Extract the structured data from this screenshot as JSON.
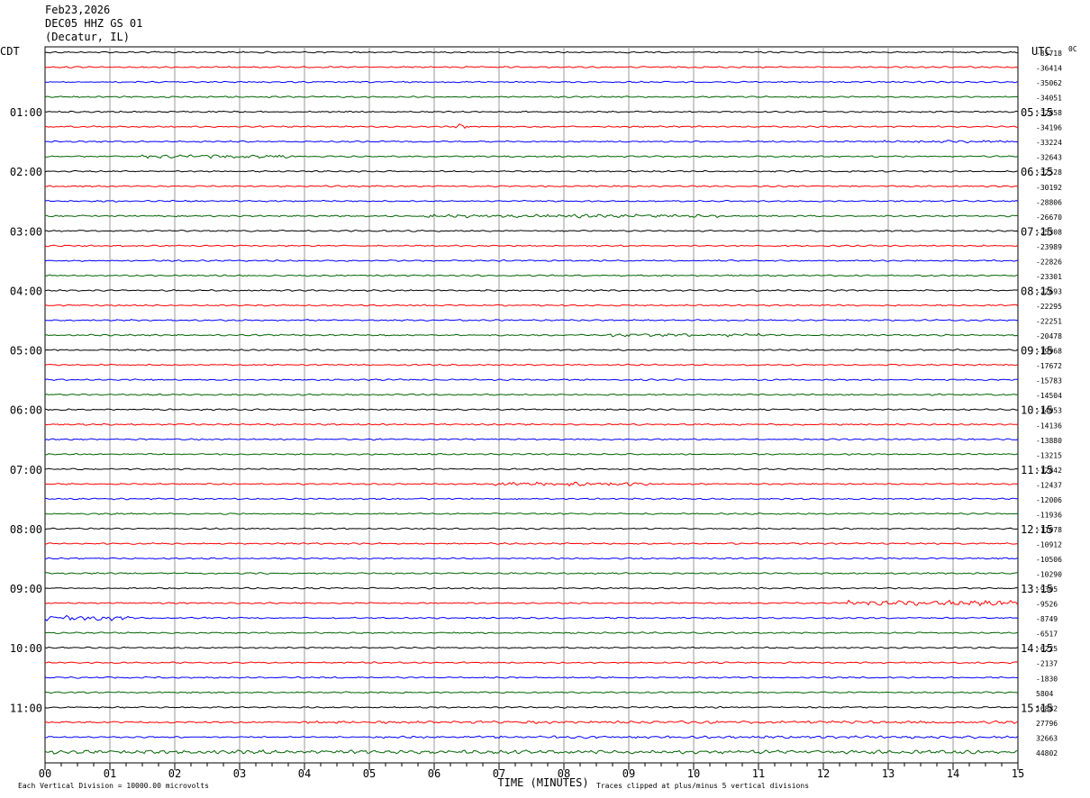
{
  "header": {
    "date": "Feb23,2026",
    "station": "DEC05 HHZ GS 01",
    "location": "(Decatur, IL)"
  },
  "left_timezone": "CDT",
  "right_timezone": "UTC",
  "corner_label": "0C",
  "footer": {
    "vertical_division": "Each Vertical Division = 10000.00 microvolts",
    "xlabel": "TIME (MINUTES)",
    "clip_note": "Traces clipped at plus/minus 5 vertical divisions"
  },
  "colors": {
    "black": "#000000",
    "red": "#ff0000",
    "blue": "#0000ff",
    "green": "#006400",
    "grid": "#999999"
  },
  "chart_data": {
    "type": "line",
    "subtype": "helicorder",
    "xlabel": "TIME (MINUTES)",
    "xlim": [
      0,
      15
    ],
    "x_ticks": [
      "00",
      "01",
      "02",
      "03",
      "04",
      "05",
      "06",
      "07",
      "08",
      "09",
      "10",
      "11",
      "12",
      "13",
      "14",
      "15"
    ],
    "rows": 48,
    "minutes_per_row": 15,
    "trace_colors": [
      "black",
      "red",
      "blue",
      "green"
    ],
    "left_hour_labels": [
      "01:00",
      "02:00",
      "03:00",
      "04:00",
      "05:00",
      "06:00",
      "07:00",
      "08:00",
      "09:00",
      "10:00",
      "11:00"
    ],
    "right_hour_labels": [
      "05:15",
      "06:15",
      "07:15",
      "08:15",
      "09:15",
      "10:15",
      "11:15",
      "12:15",
      "13:15",
      "14:15",
      "15:15"
    ],
    "trace_offsets": [
      "-35718",
      "-36414",
      "-35062",
      "-34051",
      "-32858",
      "-34196",
      "-33224",
      "-32643",
      "-32528",
      "-30192",
      "-28806",
      "-26670",
      "-25308",
      "-23989",
      "-22826",
      "-23301",
      "-22693",
      "-22295",
      "-22251",
      "-20478",
      "-19968",
      "-17672",
      "-15783",
      "-14504",
      "-14053",
      "-14136",
      "-13880",
      "-13215",
      "-12842",
      "-12437",
      "-12006",
      "-11936",
      "-11078",
      "-10912",
      "-10506",
      "-10290",
      "-9305",
      "-9526",
      "-8749",
      "-6517",
      "-6225",
      "-2137",
      "-1830",
      "5804",
      "16882",
      "27796",
      "32663",
      "44802"
    ],
    "events": [
      {
        "row": 0,
        "start_min": 3.0,
        "end_min": 3.6,
        "amp": 1.2
      },
      {
        "row": 5,
        "start_min": 6.3,
        "end_min": 6.5,
        "amp": 3.0
      },
      {
        "row": 6,
        "start_min": 12.8,
        "end_min": 15.0,
        "amp": 1.6
      },
      {
        "row": 7,
        "start_min": 1.5,
        "end_min": 3.8,
        "amp": 2.0
      },
      {
        "row": 11,
        "start_min": 5.8,
        "end_min": 10.5,
        "amp": 2.0
      },
      {
        "row": 19,
        "start_min": 8.7,
        "end_min": 11.0,
        "amp": 2.0
      },
      {
        "row": 29,
        "start_min": 6.9,
        "end_min": 9.3,
        "amp": 2.2
      },
      {
        "row": 37,
        "start_min": 12.3,
        "end_min": 15.0,
        "amp": 3.2
      },
      {
        "row": 38,
        "start_min": 0.0,
        "end_min": 1.3,
        "amp": 3.2
      },
      {
        "row": 45,
        "start_min": 4.0,
        "end_min": 15.0,
        "amp": 1.6
      },
      {
        "row": 46,
        "start_min": 5.0,
        "end_min": 15.0,
        "amp": 1.5
      },
      {
        "row": 47,
        "start_min": 0.0,
        "end_min": 15.0,
        "amp": 2.2
      }
    ]
  }
}
